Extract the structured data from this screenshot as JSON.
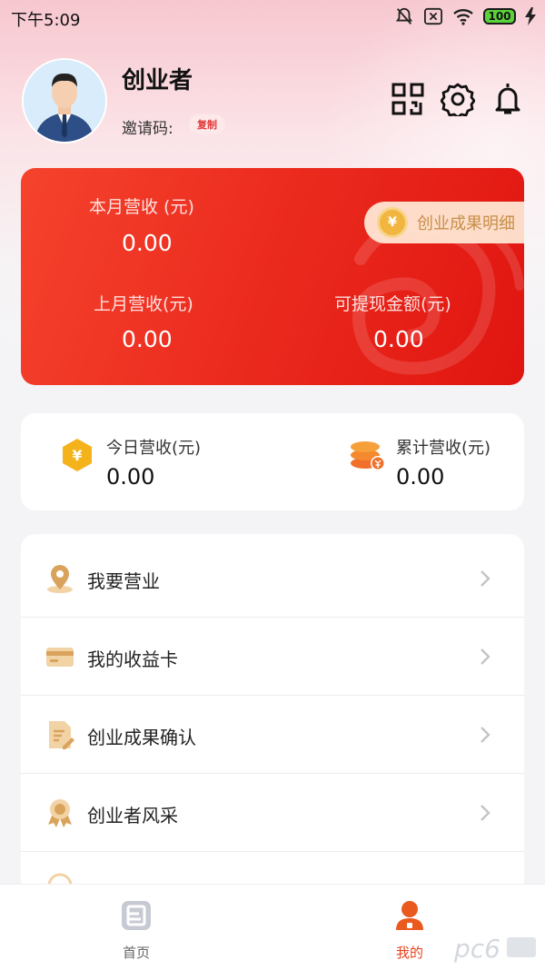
{
  "status_bar": {
    "time": "下午5:09",
    "battery": "100",
    "icons": [
      "mute-icon",
      "sim-icon",
      "wifi-icon",
      "battery-icon",
      "charging-icon"
    ]
  },
  "profile": {
    "name": "创业者",
    "invite_label": "邀请码:",
    "copy_label": "复制"
  },
  "header_icons": [
    "qr-code-icon",
    "settings-icon",
    "bell-icon"
  ],
  "revenue_card": {
    "detail_label": "创业成果明细",
    "this_month_label": "本月营收 (元)",
    "this_month_value": "0.00",
    "last_month_label": "上月营收(元)",
    "last_month_value": "0.00",
    "withdrawable_label": "可提现金额(元)",
    "withdrawable_value": "0.00",
    "coin_glyph": "¥"
  },
  "stats": {
    "today_label": "今日营收(元)",
    "today_value": "0.00",
    "total_label": "累计营收(元)",
    "total_value": "0.00",
    "coin_glyph": "¥"
  },
  "menu": [
    {
      "label": "我要营业",
      "icon": "location-pin-icon"
    },
    {
      "label": "我的收益卡",
      "icon": "card-icon"
    },
    {
      "label": "创业成果确认",
      "icon": "document-edit-icon"
    },
    {
      "label": "创业者风采",
      "icon": "award-icon"
    }
  ],
  "tabbar": {
    "home_label": "首页",
    "mine_label": "我的"
  },
  "colors": {
    "accent_red": "#ec2c1f",
    "gold": "#f2b640",
    "tab_active": "#e8441f"
  }
}
